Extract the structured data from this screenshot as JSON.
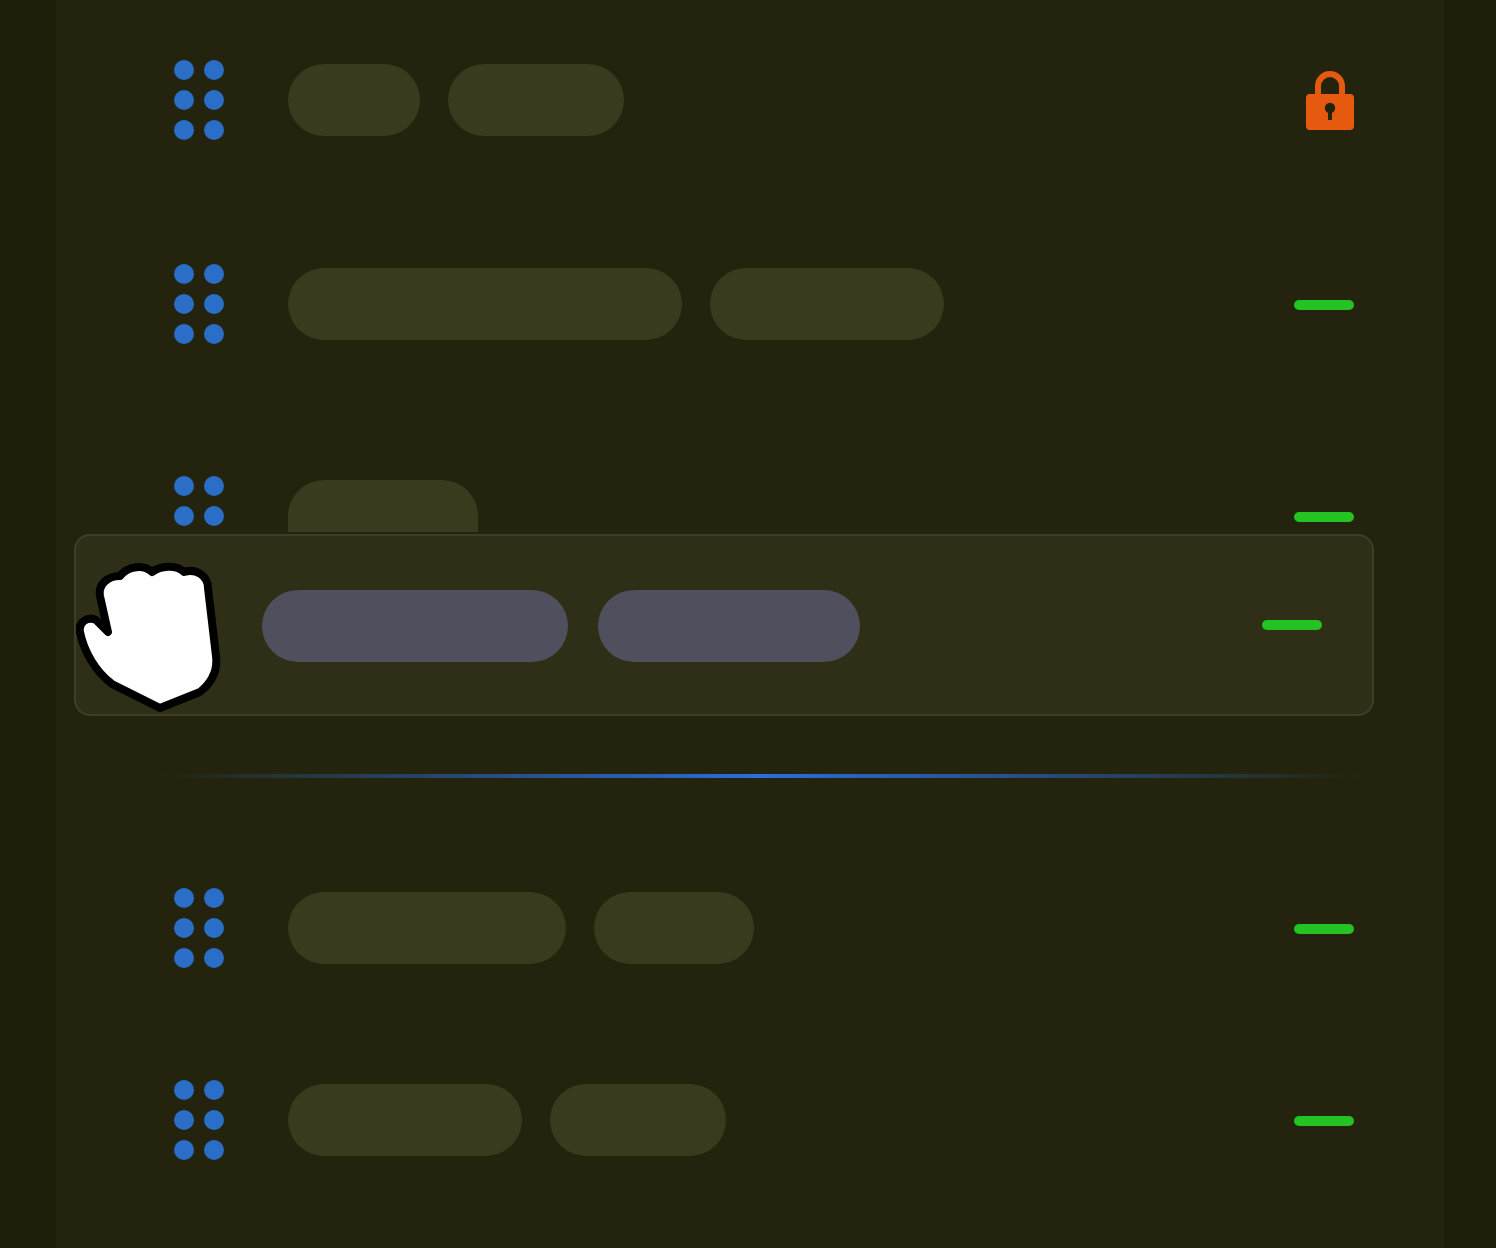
{
  "rows": [
    {
      "kind": "locked"
    },
    {
      "kind": "movable"
    },
    {
      "kind": "movable"
    },
    {
      "kind": "movable"
    },
    {
      "kind": "movable"
    }
  ],
  "dragged_row": {
    "kind": "movable"
  },
  "drop_indicator": true
}
